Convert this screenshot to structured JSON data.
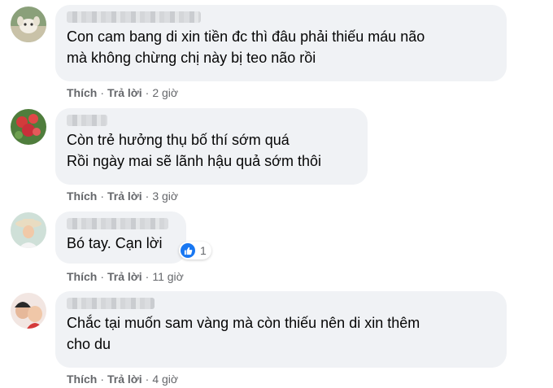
{
  "comments": [
    {
      "text": "Con cam bang di xin tiền đc thì đâu phải thiếu máu não\nmà không chừng chị này bị teo não rồi",
      "like": "Thích",
      "reply": "Trả lời",
      "time": "2 giờ"
    },
    {
      "text": "Còn trẻ hưởng thụ bố thí sớm quá\nRồi ngày mai sẽ lãnh hậu quả sớm thôi",
      "like": "Thích",
      "reply": "Trả lời",
      "time": "3 giờ"
    },
    {
      "text": "Bó tay. Cạn lời",
      "like": "Thích",
      "reply": "Trả lời",
      "time": "11 giờ",
      "reaction_count": "1"
    },
    {
      "text": "Chắc tại muốn sam vàng mà còn thiếu nên di xin thêm\ncho du",
      "like": "Thích",
      "reply": "Trả lời",
      "time": "4 giờ"
    }
  ],
  "colors": {
    "bubble": "#f0f2f5",
    "meta": "#65676b",
    "like_blue": "#1877f2"
  },
  "icons": [
    "avatar",
    "like-reaction-icon"
  ]
}
